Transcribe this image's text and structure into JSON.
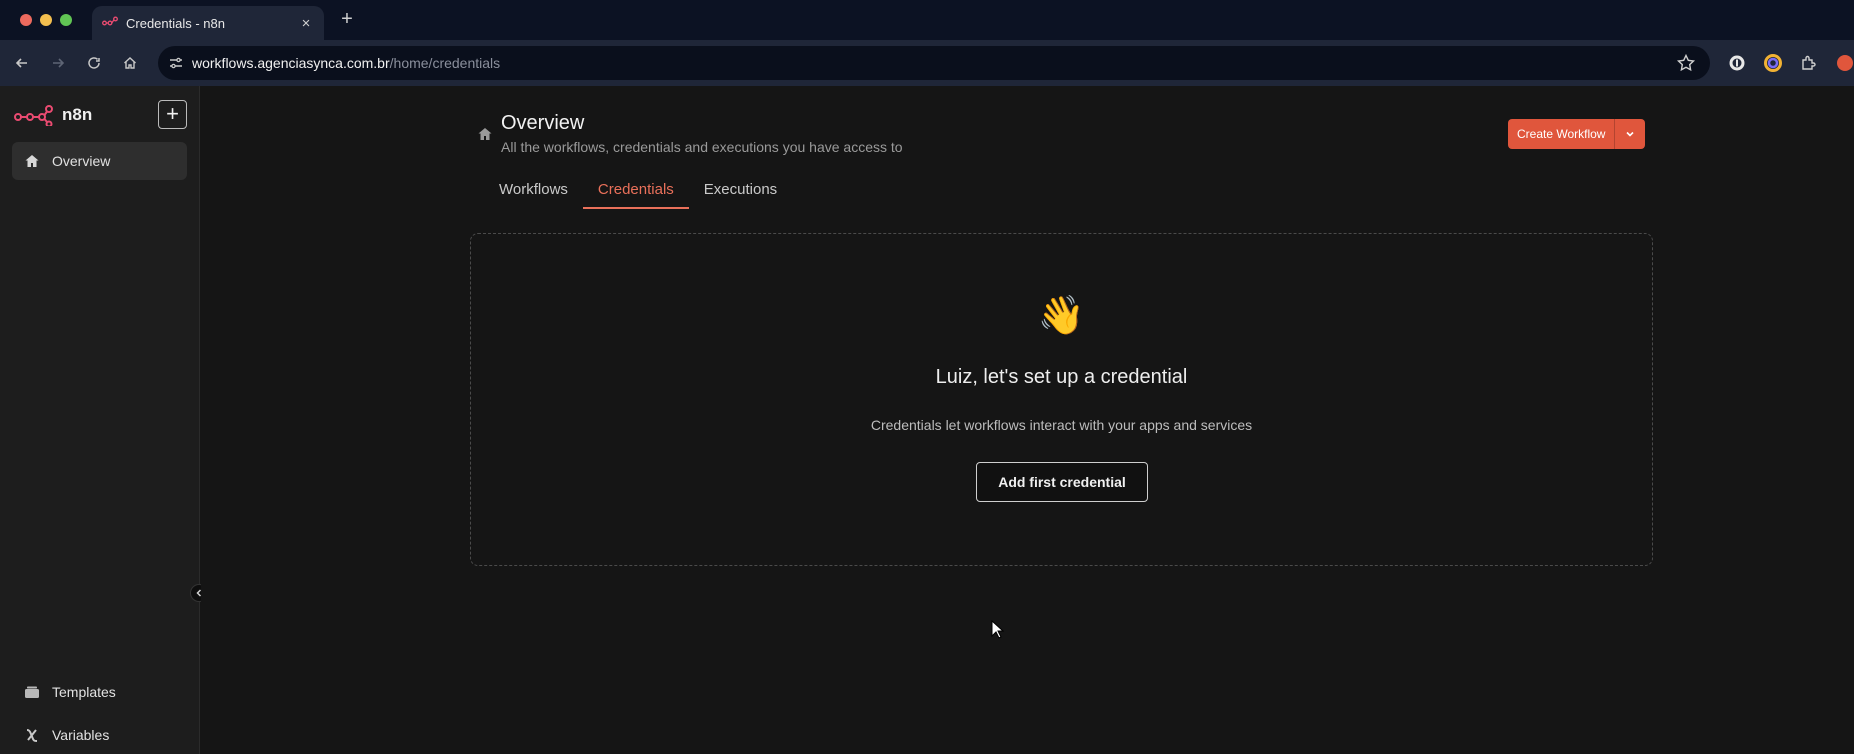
{
  "browser": {
    "tab_title": "Credentials - n8n",
    "tab_close": "×",
    "new_tab": "+",
    "url_host": "workflows.agenciasynca.com.br",
    "url_path": "/home/credentials"
  },
  "sidebar": {
    "brand": "n8n",
    "add_label": "+",
    "items": [
      {
        "label": "Overview",
        "icon": "home-icon",
        "active": true
      }
    ],
    "bottom_items": [
      {
        "label": "Templates",
        "icon": "templates-icon"
      },
      {
        "label": "Variables",
        "icon": "variables-icon"
      }
    ]
  },
  "header": {
    "title": "Overview",
    "subtitle": "All the workflows, credentials and executions you have access to",
    "create_button": "Create Workflow"
  },
  "tabs": [
    {
      "label": "Workflows",
      "active": false
    },
    {
      "label": "Credentials",
      "active": true
    },
    {
      "label": "Executions",
      "active": false
    }
  ],
  "empty_state": {
    "emoji": "👋",
    "title": "Luiz, let's set up a credential",
    "description": "Credentials let workflows interact with your apps and services",
    "button": "Add first credential"
  },
  "colors": {
    "accent": "#e0563c",
    "tab_active": "#e9705a",
    "background": "#151515",
    "sidebar": "#1d1d1d"
  }
}
